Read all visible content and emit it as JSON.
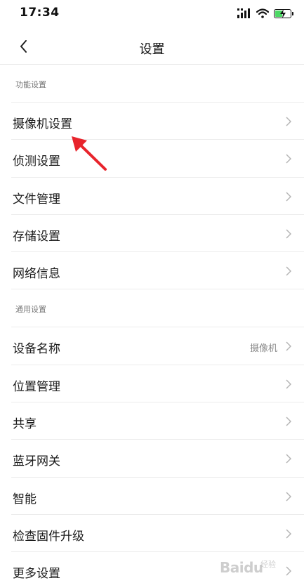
{
  "status_bar": {
    "time": "17:34",
    "icons": [
      "signal-icon",
      "wifi-icon",
      "battery-charging-icon"
    ]
  },
  "nav": {
    "back_icon": "chevron-left-icon",
    "title": "设置"
  },
  "sections": [
    {
      "header": "功能设置",
      "items": [
        {
          "label": "摄像机设置",
          "value": ""
        },
        {
          "label": "侦测设置",
          "value": ""
        },
        {
          "label": "文件管理",
          "value": ""
        },
        {
          "label": "存储设置",
          "value": ""
        },
        {
          "label": "网络信息",
          "value": ""
        }
      ]
    },
    {
      "header": "通用设置",
      "items": [
        {
          "label": "设备名称",
          "value": "摄像机"
        },
        {
          "label": "位置管理",
          "value": ""
        },
        {
          "label": "共享",
          "value": ""
        },
        {
          "label": "蓝牙网关",
          "value": ""
        },
        {
          "label": "智能",
          "value": ""
        },
        {
          "label": "检查固件升级",
          "value": ""
        },
        {
          "label": "更多设置",
          "value": ""
        }
      ]
    }
  ],
  "colors": {
    "annotation_arrow": "#e8242c",
    "battery_fill": "#4cd964",
    "divider": "#ececec"
  },
  "watermark": {
    "logo": "Baidu",
    "sub": "经验"
  }
}
